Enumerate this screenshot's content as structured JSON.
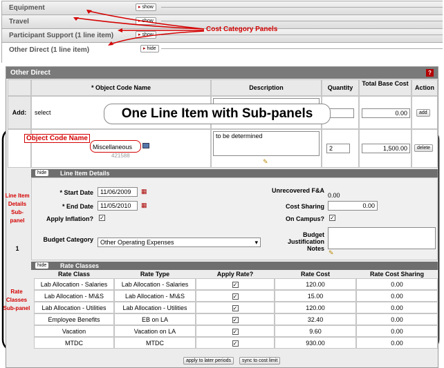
{
  "tabs": [
    {
      "label": "Equipment",
      "button": "show"
    },
    {
      "label": "Travel",
      "button": "show"
    },
    {
      "label": "Participant Support (1 line item)",
      "button": "show"
    },
    {
      "label": "Other Direct (1 line item)",
      "button": "hide"
    }
  ],
  "annotations": {
    "cost_category": "Cost Category Panels",
    "one_line": "One Line Item with Sub-panels",
    "object_code": "Object Code Name",
    "line_item": "Line Item Details Sub-panel",
    "line_item_num": "1",
    "rate_classes": "Rate Classes Sub-panel"
  },
  "panel": {
    "title": "Other Direct",
    "help": "?"
  },
  "columns": {
    "object_code": "* Object Code Name",
    "description": "Description",
    "quantity": "Quantity",
    "total_base": "Total Base Cost",
    "action": "Action"
  },
  "add_row": {
    "label": "Add:",
    "object_value": "select",
    "base_value": "0.00",
    "action": "add"
  },
  "item_row": {
    "object_name": "Miscellaneous",
    "object_code": "421588",
    "description": "to be determined",
    "quantity": "2",
    "base_value": "1,500.00",
    "action": "delete"
  },
  "details": {
    "toggle": "hide",
    "title": "Line Item Details",
    "start_label": "* Start Date",
    "start_value": "11/06/2009",
    "end_label": "* End Date",
    "end_value": "11/05/2010",
    "inflation_label": "Apply Inflation?",
    "budget_cat_label": "Budget Category",
    "budget_cat_value": "Other Operating Expenses",
    "fa_label": "Unrecovered F&A",
    "fa_value": "0.00",
    "cost_sharing_label": "Cost Sharing",
    "cost_sharing_value": "0.00",
    "campus_label": "On Campus?",
    "notes_label": "Budget Justification Notes"
  },
  "rates": {
    "toggle": "hide",
    "title": "Rate Classes",
    "headers": [
      "Rate Class",
      "Rate Type",
      "Apply Rate?",
      "Rate Cost",
      "Rate Cost Sharing"
    ],
    "rows": [
      {
        "class": "Lab Allocation - Salaries",
        "type": "Lab Allocation - Salaries",
        "cost": "120.00",
        "sharing": "0.00"
      },
      {
        "class": "Lab Allocation - M\\&S",
        "type": "Lab Allocation - M\\&S",
        "cost": "15.00",
        "sharing": "0.00"
      },
      {
        "class": "Lab Allocation - Utilities",
        "type": "Lab Allocation - Utilities",
        "cost": "120.00",
        "sharing": "0.00"
      },
      {
        "class": "Employee Benefits",
        "type": "EB on LA",
        "cost": "32.40",
        "sharing": "0.00"
      },
      {
        "class": "Vacation",
        "type": "Vacation on LA",
        "cost": "9.60",
        "sharing": "0.00"
      },
      {
        "class": "MTDC",
        "type": "MTDC",
        "cost": "930.00",
        "sharing": "0.00"
      }
    ]
  },
  "footer": {
    "apply_later": "apply to later periods",
    "sync": "sync to cost limit"
  }
}
